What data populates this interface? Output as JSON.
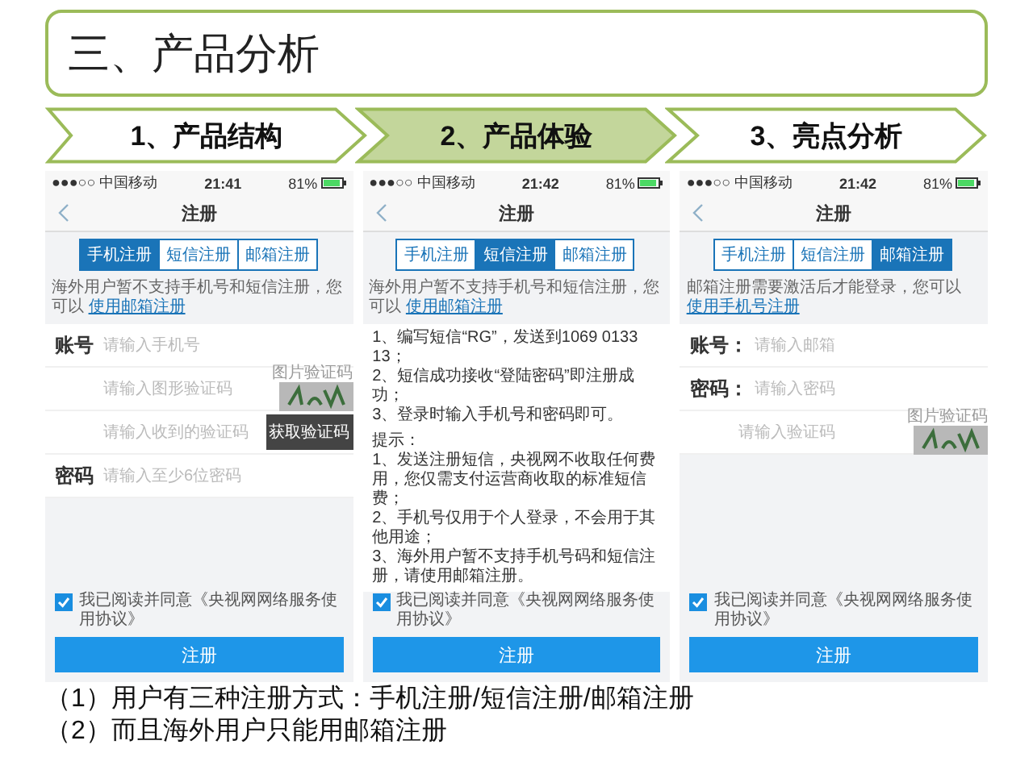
{
  "title": "三、产品分析",
  "steps": [
    {
      "label": "1、产品结构",
      "selected": false
    },
    {
      "label": "2、产品体验",
      "selected": true
    },
    {
      "label": "3、亮点分析",
      "selected": false
    }
  ],
  "phones": [
    {
      "status": {
        "carrier": "●●●○○ 中国移动",
        "time": "21:41",
        "battery": "81%"
      },
      "nav_title": "注册",
      "tabs": [
        {
          "label": "手机注册",
          "selected": true
        },
        {
          "label": "短信注册",
          "selected": false
        },
        {
          "label": "邮箱注册",
          "selected": false
        }
      ],
      "notice": {
        "text": "海外用户暂不支持手机号和短信注册，您可以",
        "link": "使用邮箱注册"
      },
      "kind": "form",
      "fields": [
        {
          "kind": "plain",
          "label": "账号",
          "placeholder": "请输入手机号"
        },
        {
          "kind": "captcha",
          "placeholder": "请输入图形验证码",
          "captcha_label": "图片验证码"
        },
        {
          "kind": "sms",
          "placeholder": "请输入收到的验证码",
          "action": "获取验证码"
        },
        {
          "kind": "plain",
          "label": "密码",
          "placeholder": "请输入至少6位密码"
        }
      ],
      "agreement": {
        "checked": true,
        "text": "我已阅读并同意《央视网网络服务使用协议》"
      },
      "submit": "注册"
    },
    {
      "status": {
        "carrier": "●●●○○ 中国移动",
        "time": "21:42",
        "battery": "81%"
      },
      "nav_title": "注册",
      "tabs": [
        {
          "label": "手机注册",
          "selected": false
        },
        {
          "label": "短信注册",
          "selected": true
        },
        {
          "label": "邮箱注册",
          "selected": false
        }
      ],
      "notice": {
        "text": "海外用户暂不支持手机号和短信注册，您可以",
        "link": "使用邮箱注册"
      },
      "kind": "instructions",
      "steps": [
        "1、编写短信“RG”，发送到1069 0133 13；",
        "2、短信成功接收“登陆密码”即注册成功；",
        "3、登录时输入手机号和密码即可。"
      ],
      "tips_title": "提示：",
      "tips": [
        "1、发送注册短信，央视网不收取任何费用，您仅需支付运营商收取的标准短信费；",
        "2、手机号仅用于个人登录，不会用于其他用途；",
        "3、海外用户暂不支持手机号码和短信注册，请使用邮箱注册。"
      ],
      "agreement": {
        "checked": true,
        "text": "我已阅读并同意《央视网网络服务使用协议》"
      },
      "submit": "注册"
    },
    {
      "status": {
        "carrier": "●●●○○ 中国移动",
        "time": "21:42",
        "battery": "81%"
      },
      "nav_title": "注册",
      "tabs": [
        {
          "label": "手机注册",
          "selected": false
        },
        {
          "label": "短信注册",
          "selected": false
        },
        {
          "label": "邮箱注册",
          "selected": true
        }
      ],
      "notice": {
        "text": "邮箱注册需要激活后才能登录，您可以",
        "link": "使用手机号注册"
      },
      "kind": "form",
      "fields": [
        {
          "kind": "plain",
          "label": "账号：",
          "placeholder": "请输入邮箱"
        },
        {
          "kind": "plain",
          "label": "密码：",
          "placeholder": "请输入密码"
        },
        {
          "kind": "captcha",
          "placeholder": "请输入验证码",
          "captcha_label": "图片验证码"
        }
      ],
      "agreement": {
        "checked": true,
        "text": "我已阅读并同意《央视网网络服务使用协议》"
      },
      "submit": "注册"
    }
  ],
  "notes": [
    "（1）用户有三种注册方式：手机注册/短信注册/邮箱注册",
    "（2）而且海外用户只能用邮箱注册"
  ]
}
